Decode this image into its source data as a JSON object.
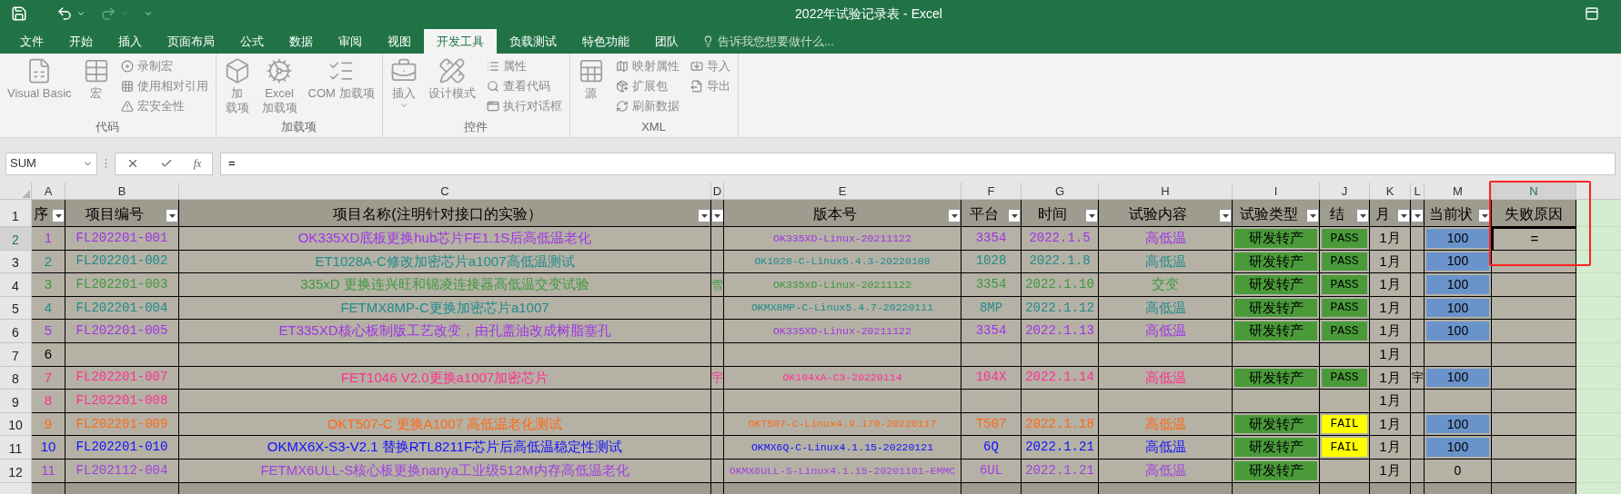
{
  "window": {
    "title": "2022年试验记录表 - Excel"
  },
  "ribbon_tabs": [
    {
      "label": "文件",
      "selected": false
    },
    {
      "label": "开始",
      "selected": false
    },
    {
      "label": "插入",
      "selected": false
    },
    {
      "label": "页面布局",
      "selected": false
    },
    {
      "label": "公式",
      "selected": false
    },
    {
      "label": "数据",
      "selected": false
    },
    {
      "label": "审阅",
      "selected": false
    },
    {
      "label": "视图",
      "selected": false
    },
    {
      "label": "开发工具",
      "selected": true
    },
    {
      "label": "负载测试",
      "selected": false
    },
    {
      "label": "特色功能",
      "selected": false
    },
    {
      "label": "团队",
      "selected": false
    }
  ],
  "tell_me": {
    "placeholder": "告诉我您想要做什么..."
  },
  "ribbon_groups": [
    {
      "title": "代码",
      "items": [
        {
          "kind": "large",
          "lines": [
            "Visual Basic"
          ]
        },
        {
          "kind": "large",
          "lines": [
            "宏"
          ]
        },
        {
          "kind": "stack",
          "labels": [
            "录制宏",
            "使用相对引用",
            "宏安全性"
          ]
        }
      ]
    },
    {
      "title": "加载项",
      "items": [
        {
          "kind": "large",
          "lines": [
            "加",
            "载项"
          ]
        },
        {
          "kind": "large",
          "lines": [
            "Excel",
            "加载项"
          ]
        },
        {
          "kind": "large",
          "lines": [
            "COM 加载项"
          ]
        }
      ]
    },
    {
      "title": "控件",
      "items": [
        {
          "kind": "dropdown",
          "lines": [
            "插入"
          ]
        },
        {
          "kind": "large",
          "lines": [
            "设计模式"
          ]
        },
        {
          "kind": "stack",
          "labels": [
            "属性",
            "查看代码",
            "执行对话框"
          ]
        }
      ]
    },
    {
      "title": "XML",
      "items": [
        {
          "kind": "large",
          "lines": [
            "源"
          ]
        },
        {
          "kind": "stack",
          "labels": [
            "映射属性",
            "扩展包",
            "刷新数据"
          ]
        },
        {
          "kind": "stack",
          "labels": [
            "导入",
            "导出"
          ]
        }
      ]
    }
  ],
  "formula_bar": {
    "name_box": "SUM",
    "function_label": "fx",
    "formula": "="
  },
  "sheet": {
    "columns": [
      {
        "letter": "A",
        "selected": false
      },
      {
        "letter": "B",
        "selected": false
      },
      {
        "letter": "C",
        "selected": false
      },
      {
        "letter": "D",
        "selected": false
      },
      {
        "letter": "E",
        "selected": false
      },
      {
        "letter": "F",
        "selected": false
      },
      {
        "letter": "G",
        "selected": false
      },
      {
        "letter": "H",
        "selected": false
      },
      {
        "letter": "I",
        "selected": false
      },
      {
        "letter": "J",
        "selected": false
      },
      {
        "letter": "K",
        "selected": false
      },
      {
        "letter": "L",
        "selected": false
      },
      {
        "letter": "M",
        "selected": false
      },
      {
        "letter": "N",
        "selected": true
      }
    ],
    "header_row": {
      "number": "1",
      "cells": [
        {
          "text": "序",
          "filter": true
        },
        {
          "text": "项目编号",
          "filter": true
        },
        {
          "text": "项目名称(注明针对接口的实验）",
          "filter": true
        },
        {
          "filter": true
        },
        {
          "text": "版本号",
          "filter": true
        },
        {
          "text": "平台",
          "filter": true
        },
        {
          "text": "时间",
          "filter": true
        },
        {
          "text": "试验内容",
          "filter": true
        },
        {
          "text": "试验类型",
          "filter": true
        },
        {
          "text": "结",
          "filter": true
        },
        {
          "text": "月",
          "filter": true
        },
        {
          "filter": true
        },
        {
          "text": "当前状",
          "filter": true
        },
        {
          "text": "失败原因",
          "filter": false
        }
      ]
    },
    "rows": [
      {
        "number": "2",
        "color": "#a033e6",
        "seq": "1",
        "code": "FL202201-001",
        "name": "OK335XD底板更换hub芯片FE1.1S后高低温老化",
        "version": "OK335XD-Linux-20211122",
        "platform": "3354",
        "date": "2022.1.5",
        "content": "高低温",
        "type": "研发转产",
        "result": {
          "text": "PASS",
          "color": "#4a9a3a"
        },
        "month": "1月",
        "status": "100",
        "status_filled": true,
        "reason": "=",
        "active": true
      },
      {
        "number": "3",
        "color": "#1e8c8c",
        "seq": "2",
        "code": "FL202201-002",
        "name": "ET1028A-C修改加密芯片a1007高低温测试",
        "version": "OK1028-C-Linux5.4.3-20220108",
        "platform": "1028",
        "date": "2022.1.8",
        "content": "高低温",
        "type": "研发转产",
        "result": {
          "text": "PASS",
          "color": "#4a9a3a"
        },
        "month": "1月",
        "status": "100",
        "status_filled": true,
        "active": false
      },
      {
        "number": "4",
        "color": "#3c9a3c",
        "seq": "3",
        "code": "FL202201-003",
        "name": "335xD 更换连兴旺和锦凌连接器高低温交变试验",
        "d": "雪",
        "version": "OK335xD-Linux-20211122",
        "platform": "3354",
        "date": "2022.1.10",
        "content": "交变",
        "type": "研发转产",
        "result": {
          "text": "PASS",
          "color": "#4a9a3a"
        },
        "month": "1月",
        "status": "100",
        "status_filled": true,
        "active": false
      },
      {
        "number": "5",
        "color": "#1e8c8c",
        "seq": "4",
        "code": "FL202201-004",
        "name": "FETMX8MP-C更换加密芯片a1007",
        "version": "OKMX8MP-C-Linux5.4.7-20220111",
        "platform": "8MP",
        "date": "2022.1.12",
        "content": "高低温",
        "type": "研发转产",
        "result": {
          "text": "PASS",
          "color": "#4a9a3a"
        },
        "month": "1月",
        "status": "100",
        "status_filled": true,
        "active": false
      },
      {
        "number": "6",
        "color": "#a033e6",
        "seq": "5",
        "code": "FL202201-005",
        "name": "ET335XD核心板制版工艺改变，由孔盖油改成树脂塞孔",
        "version": "OK335XD-Linux-20211122",
        "platform": "3354",
        "date": "2022.1.13",
        "content": "高低温",
        "type": "研发转产",
        "result": {
          "text": "PASS",
          "color": "#4a9a3a"
        },
        "month": "1月",
        "status": "100",
        "status_filled": true,
        "active": false
      },
      {
        "number": "7",
        "color": "#000000",
        "seq": "6",
        "month": "1月",
        "active": false
      },
      {
        "number": "8",
        "color": "#ff2f92",
        "seq": "7",
        "code": "FL202201-007",
        "name": "FET1046 V2.0更换a1007加密芯片",
        "d": "宇",
        "version": "OK104xA-C3-20220114",
        "platform": "104X",
        "date": "2022.1.14",
        "content": "高低温",
        "type": "研发转产",
        "result": {
          "text": "PASS",
          "color": "#4a9a3a"
        },
        "month": "1月",
        "l": "宇",
        "status": "100",
        "status_filled": true,
        "active": false
      },
      {
        "number": "9",
        "color": "#ff2f92",
        "seq": "8",
        "code": "FL202201-008",
        "month": "1月",
        "active": false
      },
      {
        "number": "10",
        "color": "#ff6a13",
        "seq": "9",
        "code": "FL202201-009",
        "name": "OKT507-C 更换A1007 高低温老化测试",
        "version": "OKT507-C-Linux4.9.170-20220117",
        "platform": "T507",
        "date": "2022.1.18",
        "content": "高低温",
        "type": "研发转产",
        "result": {
          "text": "FAIL",
          "color": "#ffff00"
        },
        "month": "1月",
        "status": "100",
        "status_filled": true,
        "active": false
      },
      {
        "number": "11",
        "color": "#1010ff",
        "seq": "10",
        "code": "FL202201-010",
        "name": "OKMX6X-S3-V2.1 替换RTL8211F芯片后高低温稳定性测试",
        "version": "OKMX6Q-C-Linux4.1.15-20220121",
        "platform": "6Q",
        "date": "2022.1.21",
        "content": "高低温",
        "type": "研发转产",
        "result": {
          "text": "FAIL",
          "color": "#ffff00"
        },
        "month": "1月",
        "status": "100",
        "status_filled": true,
        "active": false
      },
      {
        "number": "12",
        "color": "#a040e0",
        "seq": "11",
        "code": "FL202112-004",
        "name": "FETMX6ULL-S核心板更换nanya工业级512M内存高低温老化",
        "version": "OKMX6ULL-S-Linux4.1.15-20201101-EMMC",
        "platform": "6UL",
        "date": "2022.1.21",
        "content": "高低温",
        "type": "研发转产",
        "month": "1月",
        "status": "0",
        "status_filled": false,
        "active": false
      }
    ]
  },
  "annotation": {
    "kind": "red-frame"
  }
}
